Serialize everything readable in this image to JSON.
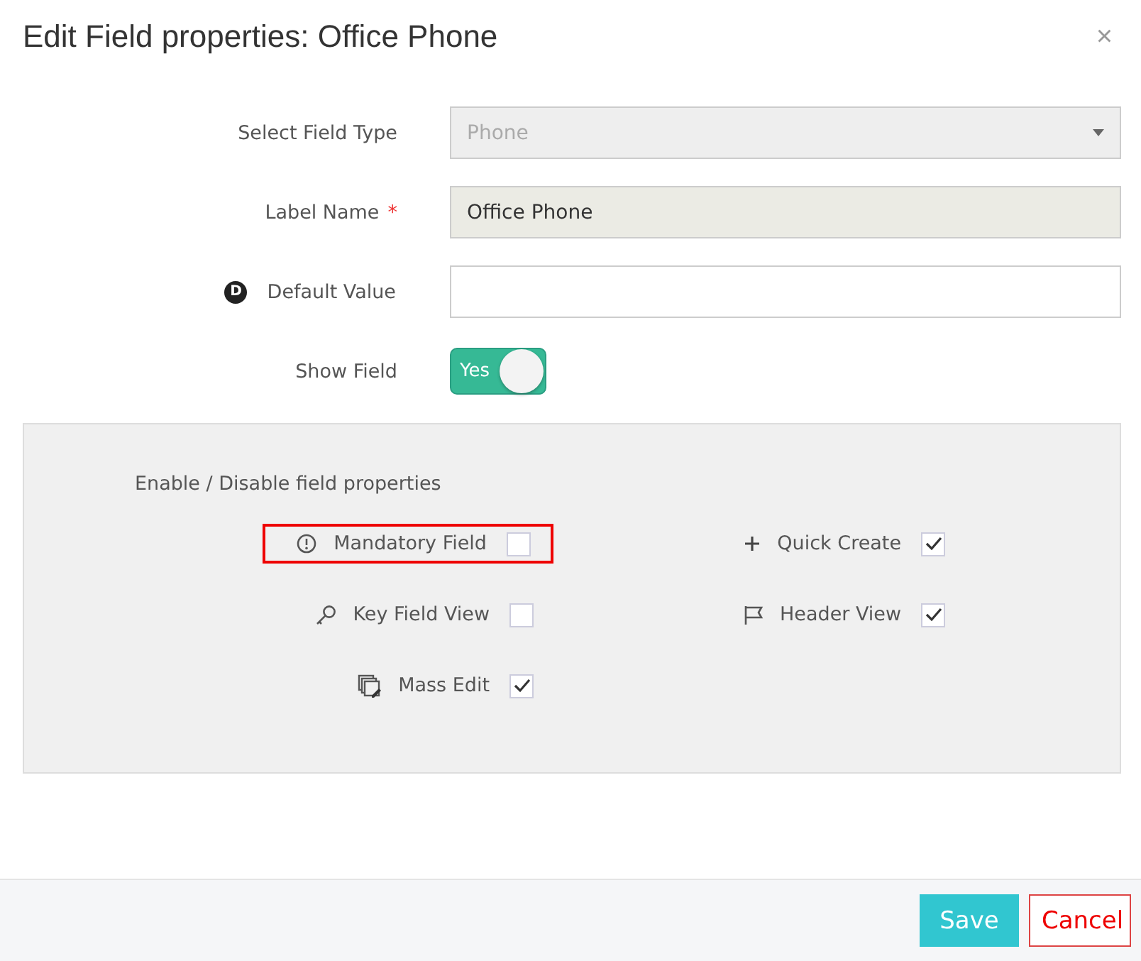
{
  "dialog": {
    "title": "Edit Field properties: Office Phone",
    "close": "×"
  },
  "fields": [
    {
      "kind": "select",
      "label": "Select Field Type",
      "value": "Phone",
      "disabled": true
    },
    {
      "kind": "text",
      "label": "Label Name",
      "required_mark": "*",
      "value": "Office Phone",
      "readonly": true
    },
    {
      "kind": "text",
      "label": "Default Value",
      "badge": "D"
    },
    {
      "kind": "toggle",
      "label": "Show Field",
      "on": true,
      "text": "Yes"
    }
  ],
  "properties": {
    "heading": "Enable / Disable field properties",
    "items": [
      {
        "label": "Mandatory Field",
        "checked": false,
        "highlighted": true
      },
      {
        "label": "Quick Create",
        "checked": true,
        "highlighted": false
      },
      {
        "label": "Key Field View",
        "checked": false,
        "highlighted": false
      },
      {
        "label": "Header View",
        "checked": true,
        "highlighted": false
      },
      {
        "label": "Mass Edit",
        "checked": true,
        "highlighted": false
      }
    ]
  },
  "buttons": [
    {
      "kind": "primary",
      "label": "Save"
    },
    {
      "kind": "cancel",
      "label": "Cancel"
    }
  ]
}
